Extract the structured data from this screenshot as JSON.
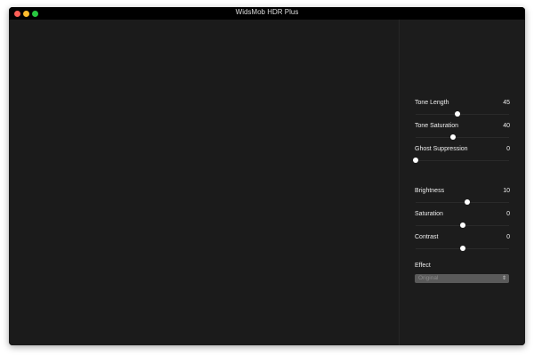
{
  "window": {
    "title": "WidsMob HDR Plus"
  },
  "colors": {
    "close": "#fe5f57",
    "minimize": "#febc2e",
    "zoom": "#28c840"
  },
  "sliders": [
    {
      "label": "Tone Length",
      "value": "45",
      "fraction": 0.45
    },
    {
      "label": "Tone Saturation",
      "value": "40",
      "fraction": 0.4
    },
    {
      "label": "Ghost Suppression",
      "value": "0",
      "fraction": 0.0
    },
    {
      "label": "Brightness",
      "value": "10",
      "fraction": 0.55
    },
    {
      "label": "Saturation",
      "value": "0",
      "fraction": 0.5
    },
    {
      "label": "Contrast",
      "value": "0",
      "fraction": 0.5
    }
  ],
  "effect": {
    "label": "Effect",
    "selected": "Original"
  }
}
